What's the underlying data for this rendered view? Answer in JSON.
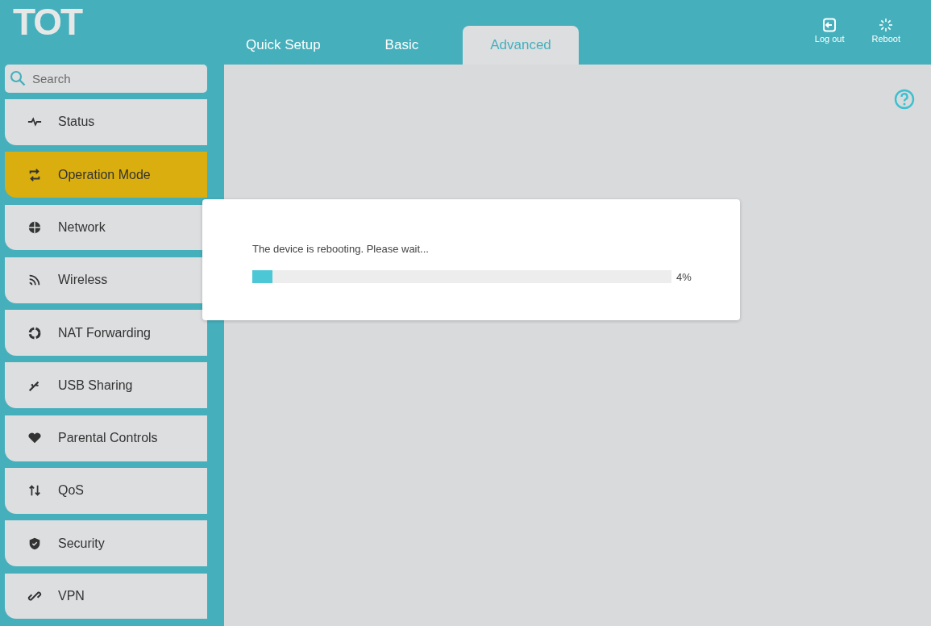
{
  "header": {
    "logo": "TOT",
    "tabs": [
      {
        "label": "Quick Setup",
        "selected": false
      },
      {
        "label": "Basic",
        "selected": false
      },
      {
        "label": "Advanced",
        "selected": true
      }
    ],
    "actions": [
      {
        "label": "Log out"
      },
      {
        "label": "Reboot"
      }
    ]
  },
  "sidebar": {
    "search": {
      "placeholder": "Search"
    },
    "items": [
      {
        "label": "Status",
        "selected": false
      },
      {
        "label": "Operation Mode",
        "selected": true
      },
      {
        "label": "Network",
        "selected": false
      },
      {
        "label": "Wireless",
        "selected": false
      },
      {
        "label": "NAT Forwarding",
        "selected": false
      },
      {
        "label": "USB Sharing",
        "selected": false
      },
      {
        "label": "Parental Controls",
        "selected": false
      },
      {
        "label": "QoS",
        "selected": false
      },
      {
        "label": "Security",
        "selected": false
      },
      {
        "label": "VPN",
        "selected": false
      }
    ]
  },
  "dialog": {
    "message": "The device is rebooting. Please wait...",
    "progress": {
      "level": 0.048,
      "reading": "4%"
    }
  }
}
